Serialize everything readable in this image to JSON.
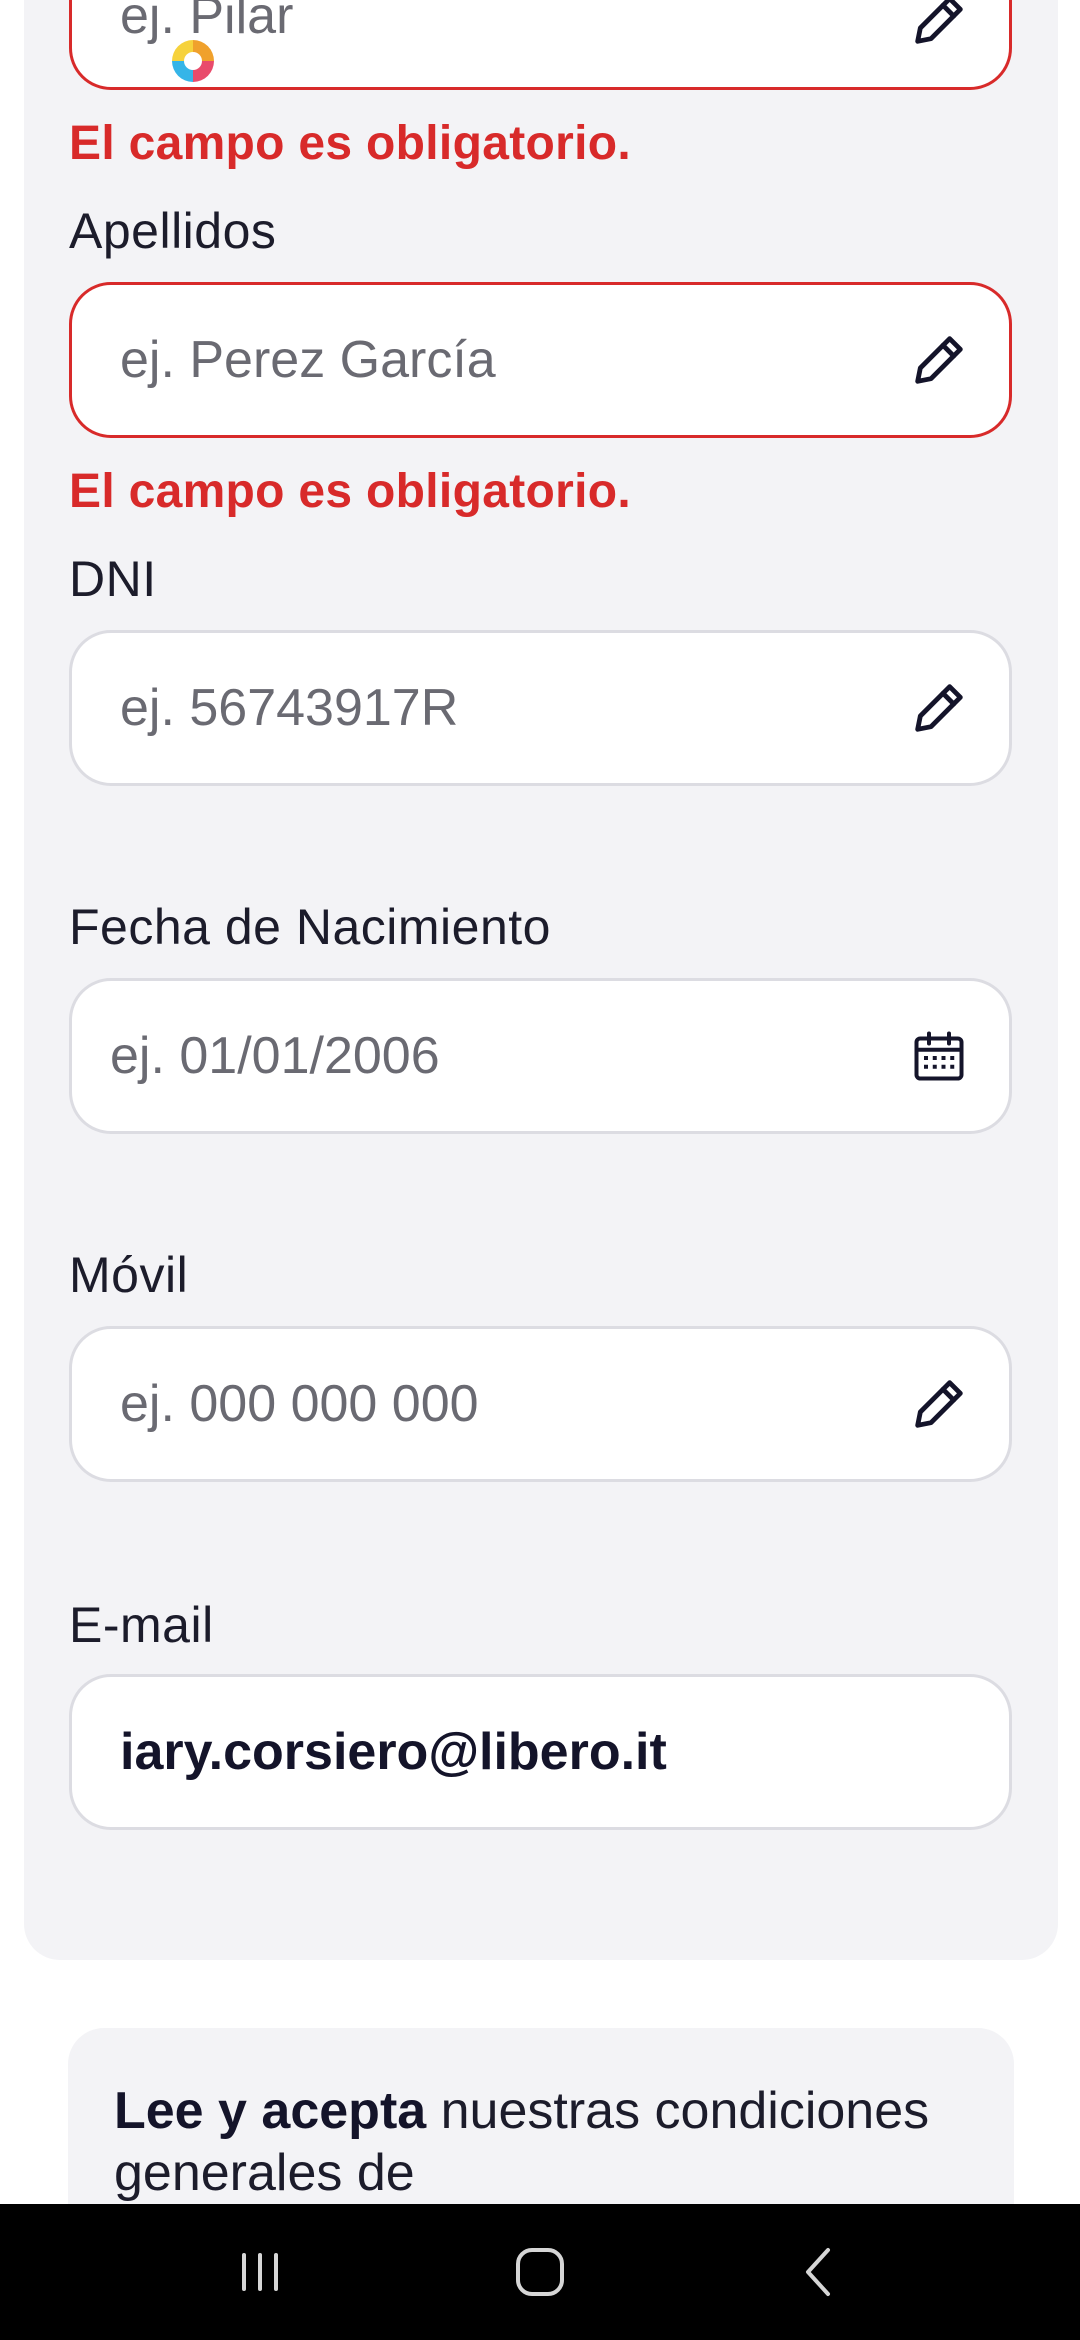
{
  "form": {
    "nombre": {
      "placeholder": "ej. Pilar",
      "error": "El campo es obligatorio."
    },
    "apellidos": {
      "label": "Apellidos",
      "placeholder": "ej. Perez García",
      "error": "El campo es obligatorio."
    },
    "dni": {
      "label": "DNI",
      "placeholder": "ej. 56743917R"
    },
    "fecha": {
      "label": "Fecha de Nacimiento",
      "placeholder": "ej. 01/01/2006"
    },
    "movil": {
      "label": "Móvil",
      "placeholder": "ej. 000 000 000"
    },
    "email": {
      "label": "E-mail",
      "value": "iary.corsiero@libero.it"
    }
  },
  "terms": {
    "bold": "Lee y acepta",
    "rest": " nuestras condiciones generales de"
  },
  "icons": {
    "edit": "pencil-icon",
    "date": "calendar-icon"
  },
  "colors": {
    "error": "#d82a2a",
    "text": "#1c1c2b",
    "card": "#f3f3f6"
  }
}
